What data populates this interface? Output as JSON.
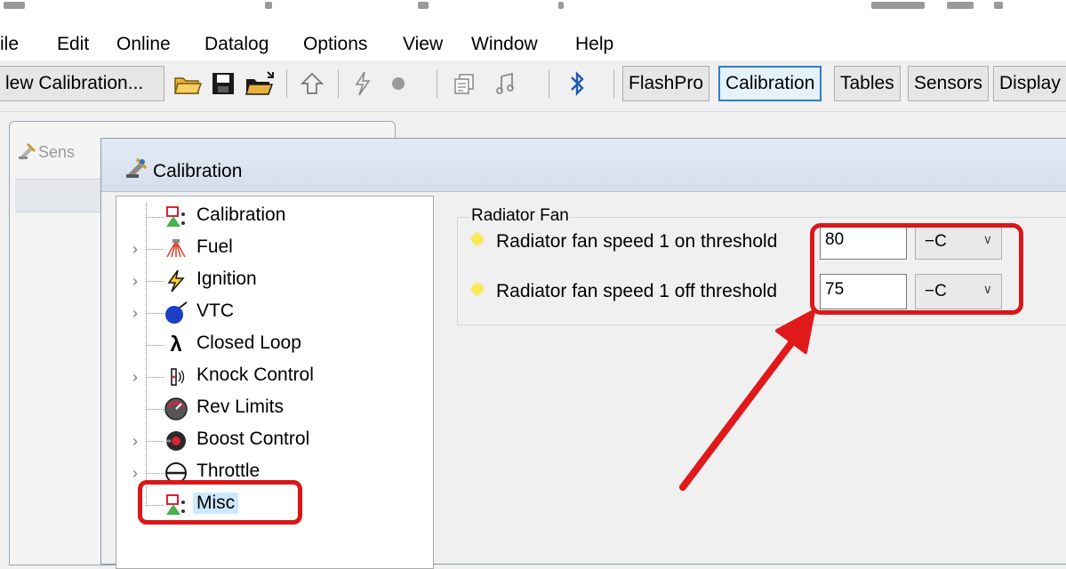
{
  "menu": {
    "items": [
      "ile",
      "Edit",
      "Online",
      "Datalog",
      "Options",
      "View",
      "Window",
      "Help"
    ]
  },
  "toolbar": {
    "new_calibration": "lew Calibration...",
    "flashpro": "FlashPro",
    "calibration": "Calibration",
    "tables": "Tables",
    "sensors": "Sensors",
    "display": "Display"
  },
  "background_window": {
    "title": "Sens"
  },
  "calibration_window": {
    "title": "Calibration",
    "tree": [
      {
        "label": "Calibration",
        "icon": "calibration-icon",
        "expandable": false
      },
      {
        "label": "Fuel",
        "icon": "fuel-icon",
        "expandable": true
      },
      {
        "label": "Ignition",
        "icon": "ignition-icon",
        "expandable": true
      },
      {
        "label": "VTC",
        "icon": "vtc-icon",
        "expandable": true
      },
      {
        "label": "Closed Loop",
        "icon": "lambda-icon",
        "expandable": false
      },
      {
        "label": "Knock Control",
        "icon": "knock-icon",
        "expandable": true
      },
      {
        "label": "Rev Limits",
        "icon": "rev-limits-icon",
        "expandable": false
      },
      {
        "label": "Boost Control",
        "icon": "boost-icon",
        "expandable": true
      },
      {
        "label": "Throttle",
        "icon": "throttle-icon",
        "expandable": true
      },
      {
        "label": "Misc",
        "icon": "misc-icon",
        "expandable": false,
        "selected": true
      }
    ],
    "group_title": "Radiator Fan",
    "rows": [
      {
        "label": "Radiator fan speed 1 on threshold",
        "value": "80",
        "unit": "−C"
      },
      {
        "label": "Radiator fan speed 1 off threshold",
        "value": "75",
        "unit": "−C"
      }
    ]
  },
  "colors": {
    "highlight": "#d81818",
    "selection": "#cce8ff",
    "active_tab_border": "#2f7fd0"
  }
}
